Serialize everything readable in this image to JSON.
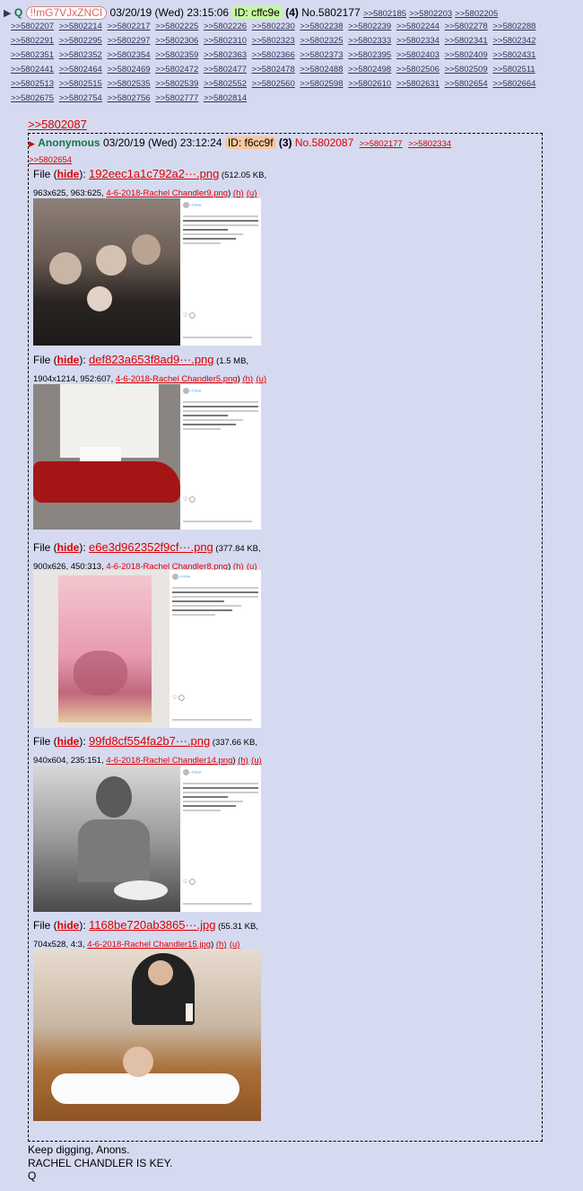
{
  "post": {
    "collapse_icon": "▶",
    "name": "Q",
    "tripcode": "!!mG7VJxZNCI",
    "datetime": "03/20/19 (Wed) 23:15:06",
    "id_label": "ID: cffc9e",
    "id_color": "#c5f7a0",
    "reply_count": "(4)",
    "number": "No.5802177",
    "replies": [
      ">>5802185",
      ">>5802203",
      ">>5802205",
      ">>5802207",
      ">>5802214",
      ">>5802217",
      ">>5802225",
      ">>5802226",
      ">>5802230",
      ">>5802238",
      ">>5802239",
      ">>5802244",
      ">>5802278",
      ">>5802288",
      ">>5802291",
      ">>5802295",
      ">>5802297",
      ">>5802306",
      ">>5802310",
      ">>5802323",
      ">>5802325",
      ">>5802333",
      ">>5802334",
      ">>5802341",
      ">>5802342",
      ">>5802351",
      ">>5802352",
      ">>5802354",
      ">>5802359",
      ">>5802363",
      ">>5802366",
      ">>5802373",
      ">>5802395",
      ">>5802403",
      ">>5802409",
      ">>5802431",
      ">>5802441",
      ">>5802464",
      ">>5802469",
      ">>5802472",
      ">>5802477",
      ">>5802478",
      ">>5802488",
      ">>5802498",
      ">>5802506",
      ">>5802509",
      ">>5802511",
      ">>5802513",
      ">>5802515",
      ">>5802535",
      ">>5802539",
      ">>5802552",
      ">>5802560",
      ">>5802598",
      ">>5802610",
      ">>5802631",
      ">>5802654",
      ">>5802664",
      ">>5802675",
      ">>5802754",
      ">>5802756",
      ">>5802777",
      ">>5802814"
    ],
    "quote_link": ">>5802087",
    "body_lines": [
      "Keep digging, Anons.",
      "RACHEL CHANDLER IS KEY.",
      "Q"
    ]
  },
  "quoted": {
    "arrow_icon": "▶",
    "name": "Anonymous",
    "datetime": "03/20/19 (Wed) 23:12:24",
    "id_label": "ID: f6cc9f",
    "id_color": "#f8c89c",
    "reply_count": "(3)",
    "number": "No.5802087",
    "replies": [
      ">>5802177",
      ">>5802334",
      ">>5802654"
    ],
    "files": [
      {
        "prefix": "File (",
        "hide": "hide",
        "mid": "): ",
        "name": "192eec1a1c792a2···.png",
        "meta1": " (512.05 KB,",
        "meta2": "963x625, 963:625, ",
        "orig": "4-6-2018-Rachel Chandler9.png",
        "tail": ") ",
        "h": "(h)",
        "u": "(u)"
      },
      {
        "prefix": "File (",
        "hide": "hide",
        "mid": "): ",
        "name": "def823a653f8ad9···.png",
        "meta1": " (1.5 MB,",
        "meta2": "1904x1214, 952:607, ",
        "orig": "4-6-2018-Rachel Chandler5.png",
        "tail": ") ",
        "h": "(h)",
        "u": "(u)"
      },
      {
        "prefix": "File (",
        "hide": "hide",
        "mid": "): ",
        "name": "e6e3d962352f9cf···.png",
        "meta1": " (377.84 KB,",
        "meta2": "900x626, 450:313, ",
        "orig": "4-6-2018-Rachel Chandler8.png",
        "tail": ") ",
        "h": "(h)",
        "u": "(u)"
      },
      {
        "prefix": "File (",
        "hide": "hide",
        "mid": "): ",
        "name": "99fd8cf554fa2b7···.png",
        "meta1": " (337.66 KB,",
        "meta2": "940x604, 235:151, ",
        "orig": "4-6-2018-Rachel Chandler14.png",
        "tail": ") ",
        "h": "(h)",
        "u": "(u)"
      },
      {
        "prefix": "File (",
        "hide": "hide",
        "mid": "): ",
        "name": "1168be720ab3865···.jpg",
        "meta1": " (55.31 KB,",
        "meta2": "704x528, 4:3, ",
        "orig": "4-6-2018-Rachel Chandler15.jpg",
        "tail": ") ",
        "h": "(h)",
        "u": "(u)"
      }
    ]
  },
  "colors": {
    "board_bg": "#d6daf0",
    "name_green": "#117743",
    "link_red": "#dd0000",
    "link_blue": "#34345c"
  }
}
